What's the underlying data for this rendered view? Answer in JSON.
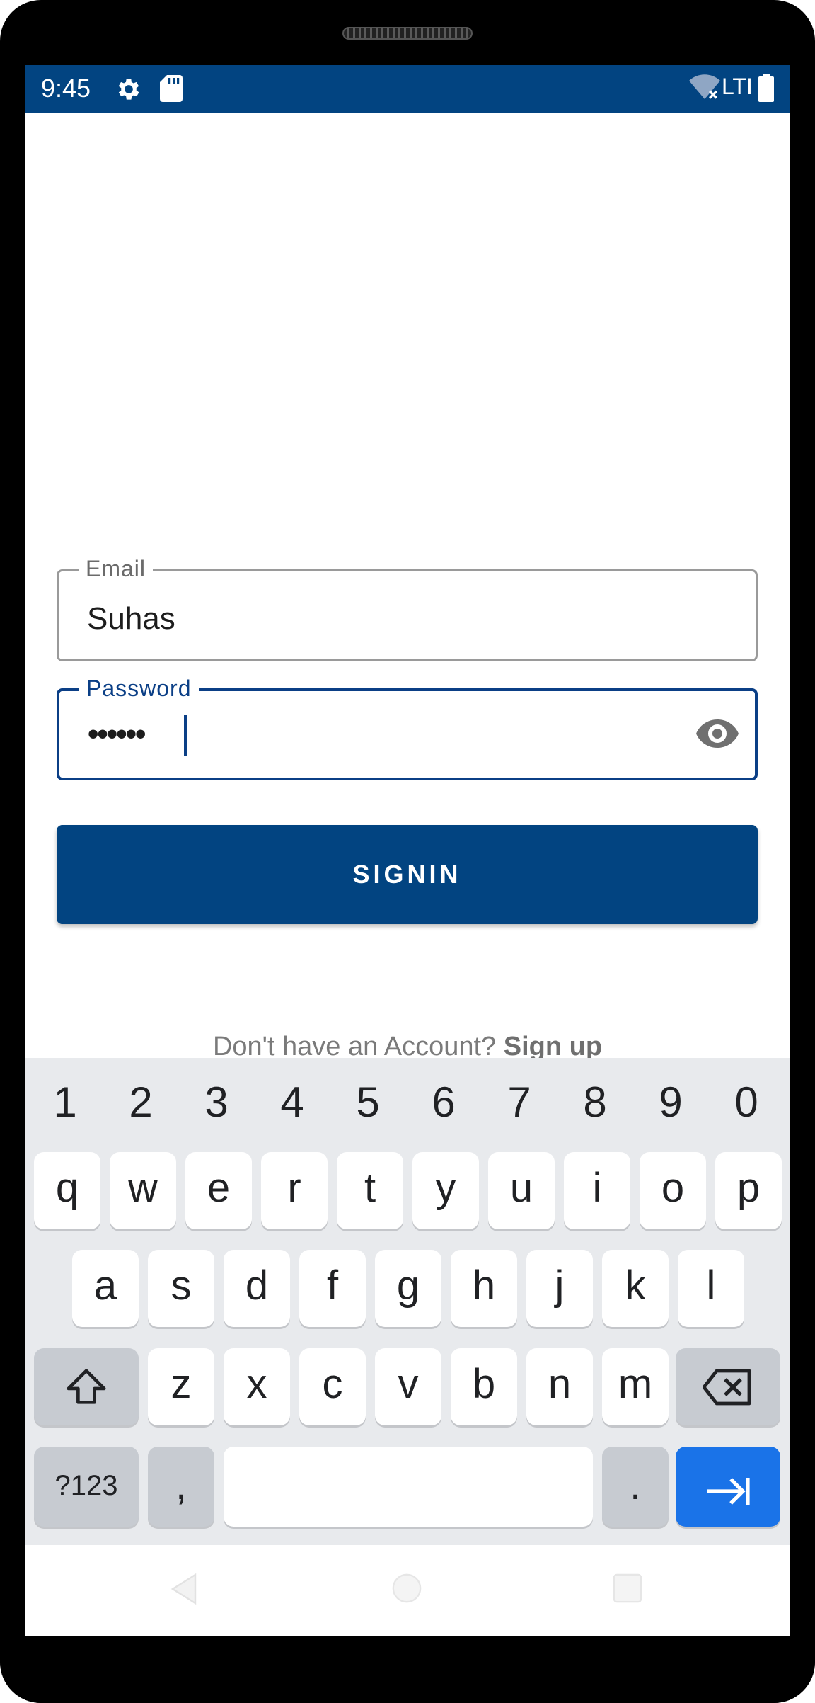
{
  "status_bar": {
    "time": "9:45",
    "network": "LTI",
    "icons": [
      "gear-icon",
      "sd-card-icon",
      "wifi-off-icon",
      "battery-icon"
    ],
    "background": "#024481"
  },
  "form": {
    "email_label": "Email",
    "email_value": "Suhas",
    "password_label": "Password",
    "password_value": "••••••",
    "signin_label": "SIGNIN",
    "signup_prompt": "Don't have an Account?",
    "signup_link": "Sign up"
  },
  "keyboard": {
    "numbers": [
      "1",
      "2",
      "3",
      "4",
      "5",
      "6",
      "7",
      "8",
      "9",
      "0"
    ],
    "row1": [
      "q",
      "w",
      "e",
      "r",
      "t",
      "y",
      "u",
      "i",
      "o",
      "p"
    ],
    "row2": [
      "a",
      "s",
      "d",
      "f",
      "g",
      "h",
      "j",
      "k",
      "l"
    ],
    "row3": [
      "z",
      "x",
      "c",
      "v",
      "b",
      "n",
      "m"
    ],
    "symbols_label": "?123",
    "comma": ",",
    "period": "."
  },
  "colors": {
    "primary": "#024481",
    "focus": "#0b3f86",
    "enter": "#1a73e8"
  }
}
